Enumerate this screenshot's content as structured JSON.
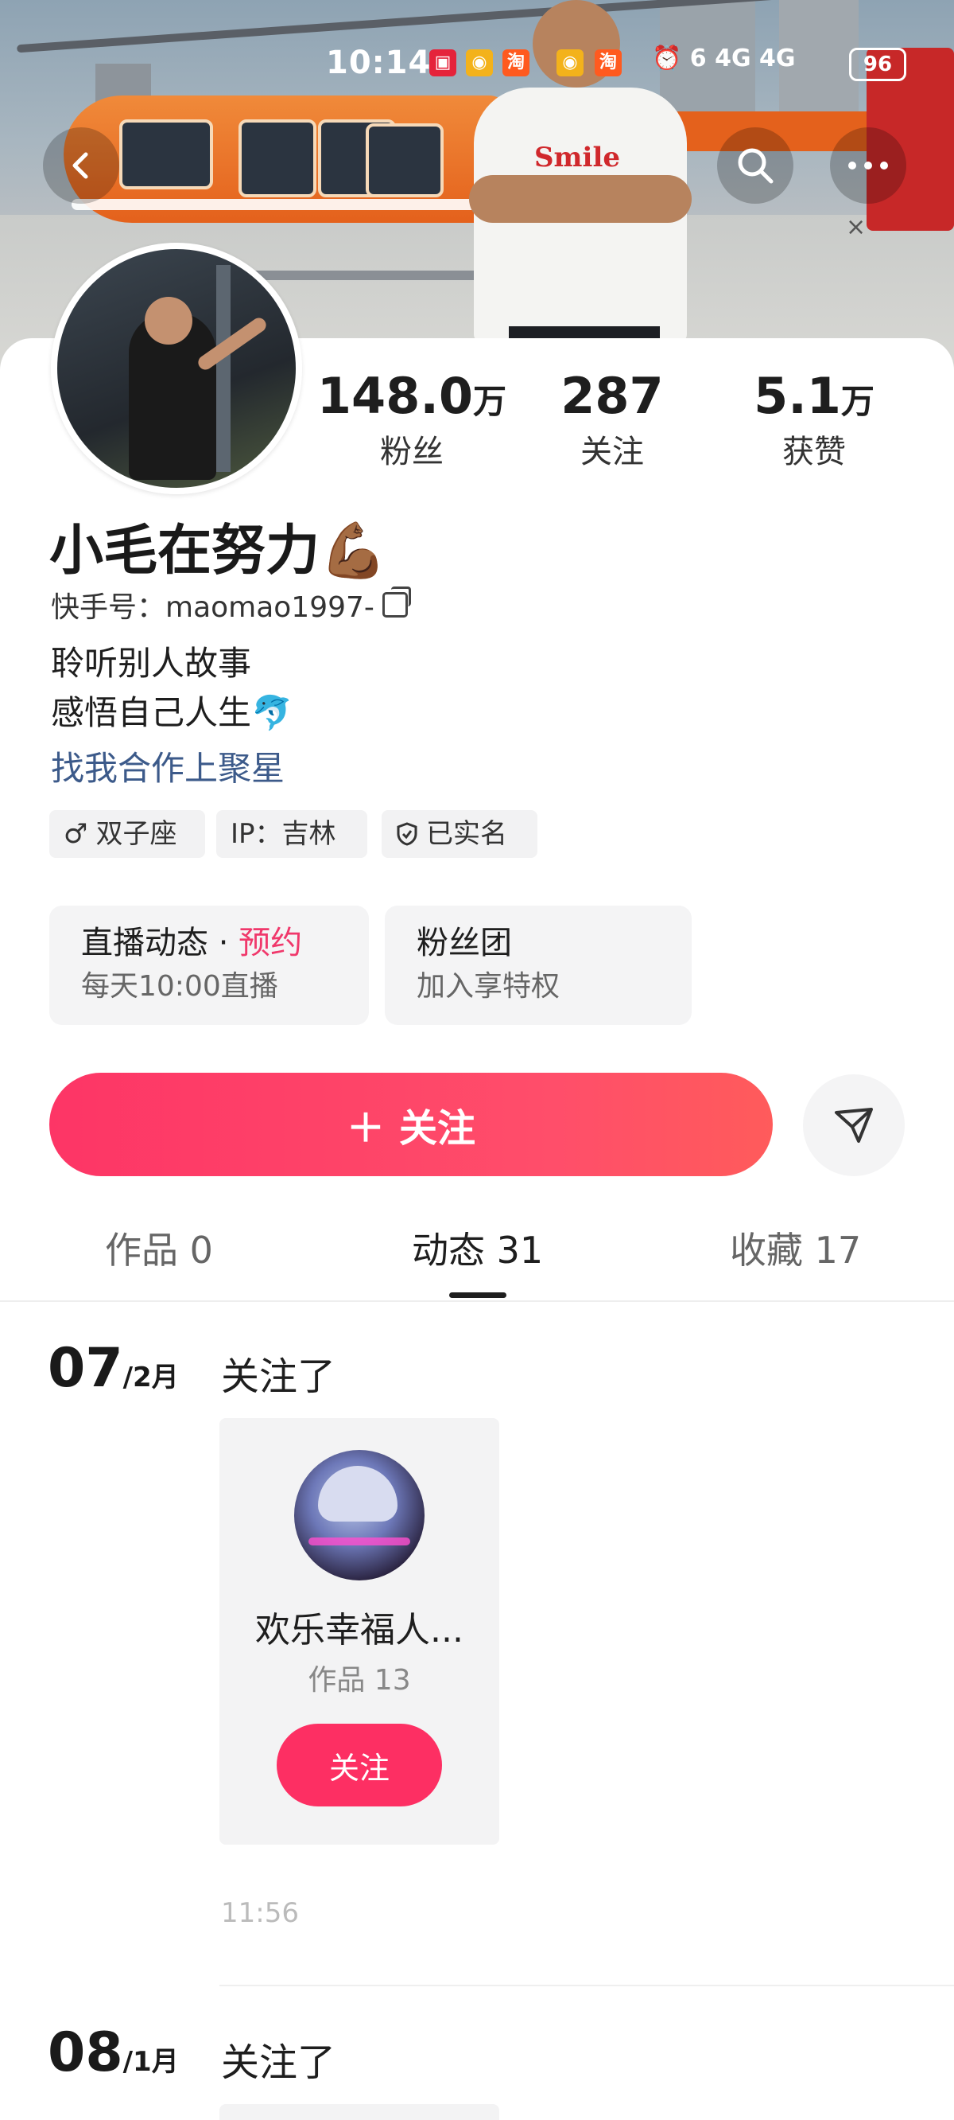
{
  "status_bar": {
    "time": "10:14",
    "right_text": "⏰ 6 4G 4G",
    "battery": "96",
    "notification_icons": [
      "xiaohongshu-icon",
      "weibo-icon",
      "taobao-icon",
      "weibo-icon",
      "taobao-icon"
    ]
  },
  "profile": {
    "name": "小毛在努力💪🏾",
    "kwai_id": "快手号：maomao1997-",
    "bio_line1": "聆听别人故事",
    "bio_line2": "感悟自己人生🐬",
    "collab_link": "找我合作上聚星",
    "stats": [
      {
        "value": "148.0",
        "unit": "万",
        "label": "粉丝"
      },
      {
        "value": "287",
        "unit": "",
        "label": "关注"
      },
      {
        "value": "5.1",
        "unit": "万",
        "label": "获赞"
      }
    ],
    "chips": [
      {
        "icon": "male-icon",
        "text": "双子座"
      },
      {
        "icon": "",
        "text": "IP：吉林"
      },
      {
        "icon": "verified-shield-icon",
        "text": "已实名"
      }
    ]
  },
  "features": [
    {
      "title": "直播动态",
      "dot": " · ",
      "highlight": "预约",
      "subtitle": "每天10:00直播"
    },
    {
      "title": "粉丝团",
      "dot": "",
      "highlight": "",
      "subtitle": "加入享特权"
    }
  ],
  "actions": {
    "follow_label": "关注",
    "follow_icon": "＋"
  },
  "tabs": [
    {
      "label": "作品 0",
      "active": false
    },
    {
      "label": "动态 31",
      "active": true
    },
    {
      "label": "收藏 17",
      "active": false
    }
  ],
  "feed": [
    {
      "day": "07",
      "month": "/2月",
      "action": "关注了",
      "card": {
        "name": "欢乐幸福人...",
        "works": "作品 13",
        "button": "关注"
      },
      "time": "11:56"
    },
    {
      "day": "08",
      "month": "/1月",
      "action": "关注了"
    }
  ],
  "colors": {
    "accent": "#fd3566",
    "link": "#3c5a8a",
    "highlight": "#f0386b"
  }
}
